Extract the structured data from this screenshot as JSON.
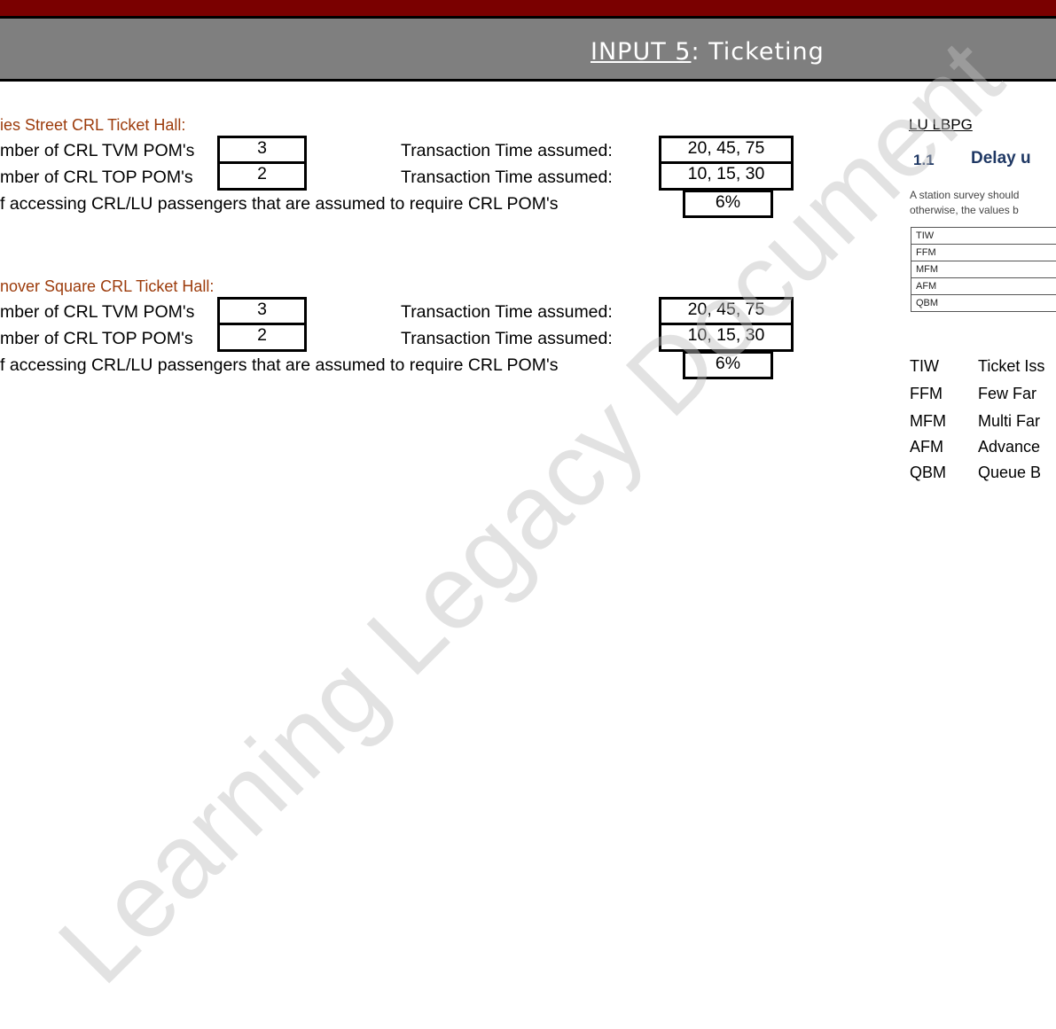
{
  "header": {
    "title_underlined": "INPUT 5",
    "title_rest": ": Ticketing"
  },
  "sections": [
    {
      "title": "ies Street CRL Ticket Hall:",
      "tvm_label": "mber of CRL TVM POM's",
      "tvm_count": "3",
      "tvm_txn_label": "Transaction Time assumed:",
      "tvm_txn_value": "20, 45, 75",
      "top_label": "mber of CRL TOP POM's",
      "top_count": "2",
      "top_txn_label": "Transaction Time assumed:",
      "top_txn_value": "10, 15, 30",
      "pct_label": "f accessing CRL/LU passengers that are assumed to require CRL POM's",
      "pct_value": "6%"
    },
    {
      "title": "nover Square CRL Ticket Hall:",
      "tvm_label": "mber of CRL TVM POM's",
      "tvm_count": "3",
      "tvm_txn_label": "Transaction Time assumed:",
      "tvm_txn_value": "20, 45, 75",
      "top_label": "mber of CRL TOP POM's",
      "top_count": "2",
      "top_txn_label": "Transaction Time assumed:",
      "top_txn_value": "10, 15, 30",
      "pct_label": "f accessing CRL/LU passengers that are assumed to require CRL POM's",
      "pct_value": "6%"
    }
  ],
  "reference": {
    "title": "LU LBPG",
    "section_number": "1.1",
    "heading": "Delay u",
    "text_line1": "A station survey should",
    "text_line2": "otherwise, the values b",
    "table_rows": [
      "TIW",
      "FFM",
      "MFM",
      "AFM",
      "QBM"
    ]
  },
  "abbreviations": [
    {
      "code": "TIW",
      "desc": "Ticket Iss"
    },
    {
      "code": "FFM",
      "desc": "Few Far"
    },
    {
      "code": "MFM",
      "desc": "Multi Far"
    },
    {
      "code": "AFM",
      "desc": "Advance"
    },
    {
      "code": "QBM",
      "desc": "Queue B"
    }
  ],
  "watermark": "Learning Legacy Document"
}
